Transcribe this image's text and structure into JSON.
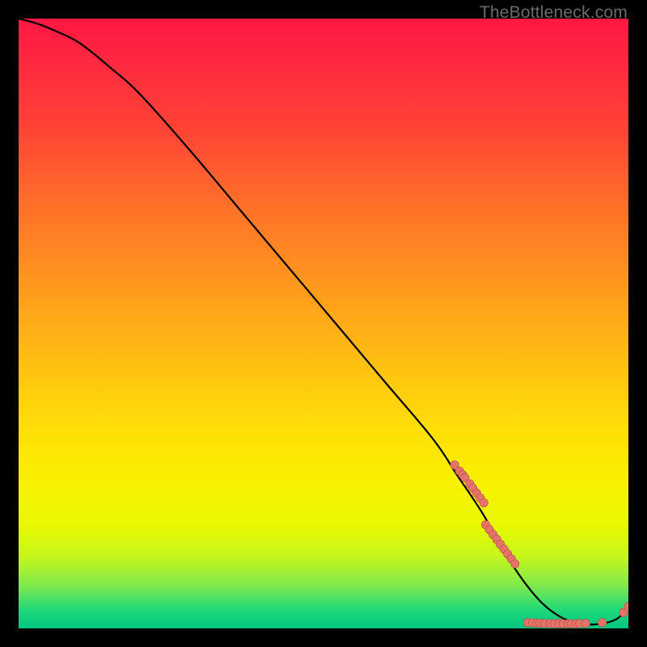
{
  "watermark": "TheBottleneck.com",
  "colors": {
    "curve_stroke": "#000000",
    "dot_fill": "#e57368",
    "dot_stroke": "#b84d49"
  },
  "chart_data": {
    "type": "line",
    "title": "",
    "xlabel": "",
    "ylabel": "",
    "xlim": [
      0,
      100
    ],
    "ylim": [
      0,
      100
    ],
    "series": [
      {
        "name": "bottleneck-curve",
        "x": [
          0,
          3,
          6,
          10,
          15,
          20,
          28,
          36,
          44,
          52,
          60,
          68,
          72,
          76,
          80,
          83,
          86,
          89,
          92,
          95,
          98,
          100
        ],
        "y": [
          100,
          99.2,
          98,
          96,
          92,
          87.5,
          78.5,
          69,
          59.5,
          50,
          40.5,
          31,
          25,
          19,
          12,
          7.5,
          4,
          1.8,
          0.8,
          0.7,
          1.5,
          3.5
        ]
      }
    ],
    "scatter": [
      {
        "name": "segment-markers-upper",
        "x": [
          71.5,
          72.3,
          72.8,
          73.2,
          74.0,
          74.5,
          75.1,
          75.7,
          76.3
        ],
        "y": [
          26.8,
          25.8,
          25.2,
          24.7,
          23.7,
          23.0,
          22.2,
          21.4,
          20.6
        ]
      },
      {
        "name": "segment-markers-lower",
        "x": [
          76.6,
          77.2,
          77.8,
          78.4,
          79.0,
          79.6,
          80.2,
          80.8,
          81.4
        ],
        "y": [
          17.0,
          16.2,
          15.4,
          14.6,
          13.8,
          13.0,
          12.2,
          11.4,
          10.6
        ]
      },
      {
        "name": "floor-markers",
        "x": [
          83.5,
          84.3,
          85.0,
          85.5,
          86.2,
          87.2,
          87.9,
          88.6,
          89.3,
          90.1,
          90.7,
          91.4,
          92.0,
          93.0,
          95.7
        ],
        "y": [
          0.95,
          0.9,
          0.86,
          0.84,
          0.82,
          0.8,
          0.79,
          0.78,
          0.77,
          0.77,
          0.77,
          0.78,
          0.79,
          0.81,
          0.95
        ]
      },
      {
        "name": "right-end-markers",
        "x": [
          99.2,
          100.0
        ],
        "y": [
          2.6,
          3.6
        ]
      }
    ]
  }
}
